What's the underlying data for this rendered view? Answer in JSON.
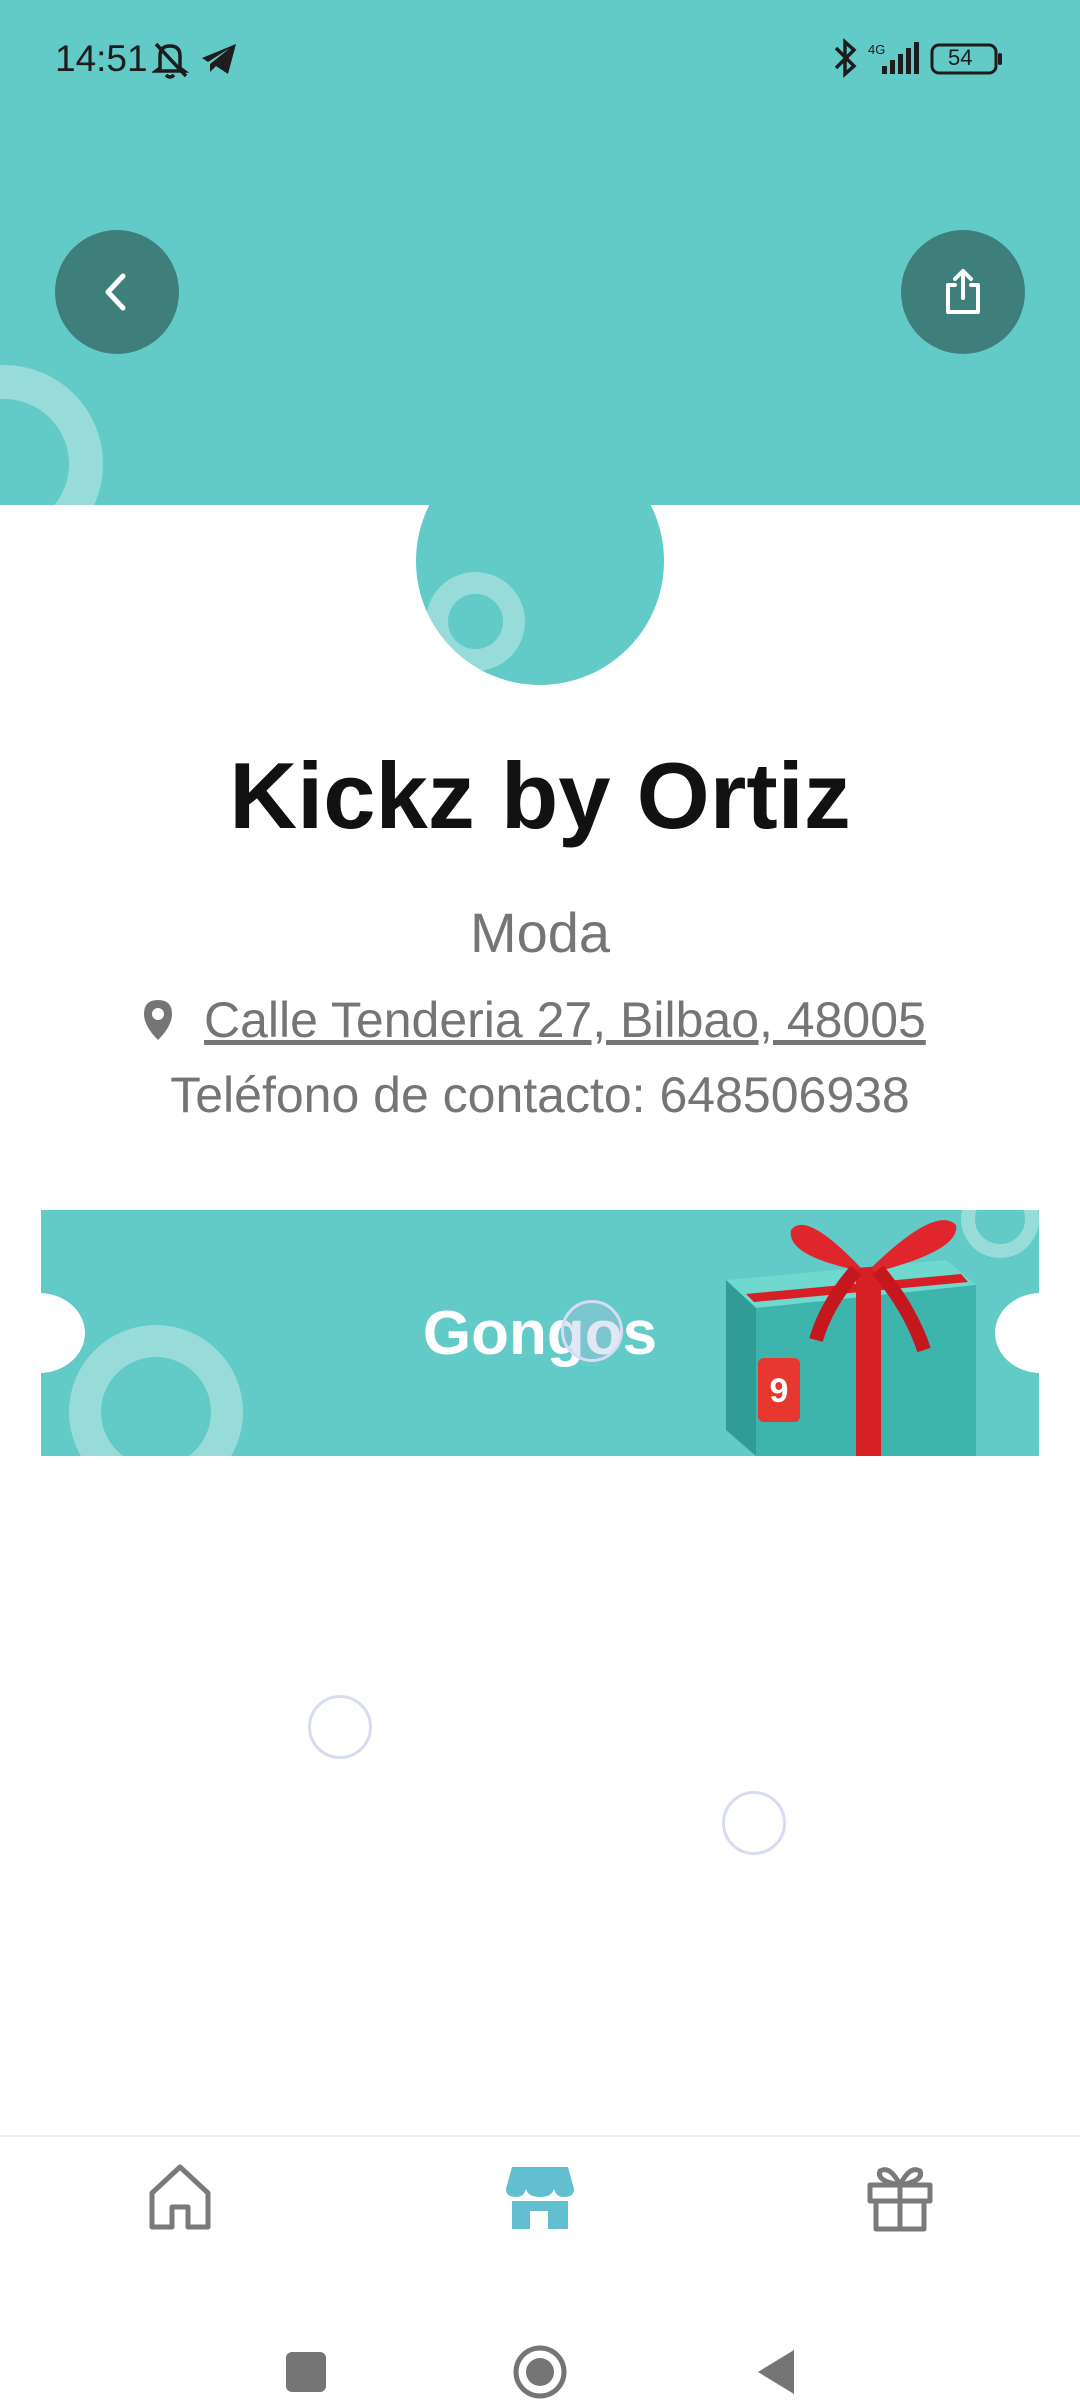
{
  "status_bar": {
    "time": "14:51",
    "network": "4G",
    "battery": "54"
  },
  "store": {
    "name": "Kickz by Ortiz",
    "category": "Moda",
    "address": "Calle Tenderia 27, Bilbao, 48005",
    "phone": "Teléfono de contacto: 648506938"
  },
  "banner": {
    "title": "Gongos",
    "badge": "9"
  },
  "icons": {
    "back": "chevron-left-icon",
    "share": "share-icon",
    "location": "map-pin-icon",
    "home": "home-icon",
    "store": "store-icon",
    "gift": "gift-icon"
  },
  "colors": {
    "accent": "#62cac7",
    "button": "#3e7f7c",
    "active_nav": "#62bfd0",
    "inactive_nav": "#7a7a7a"
  }
}
